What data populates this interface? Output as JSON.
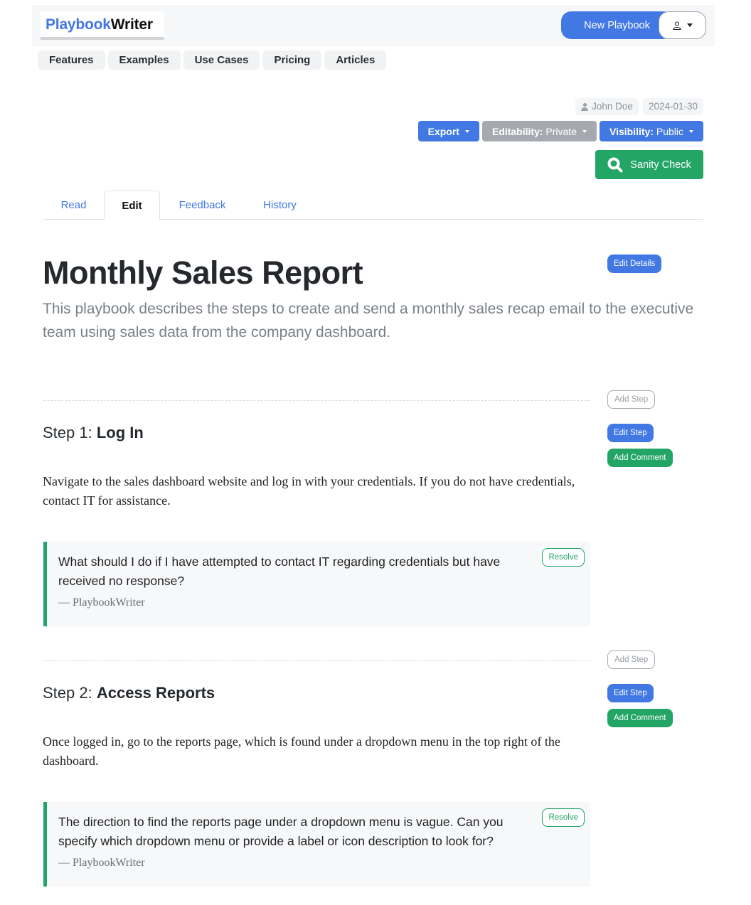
{
  "navbar": {
    "brand_part1": "Playbook",
    "brand_part2": "Writer",
    "new_playbook_label": "New Playbook",
    "user_menu_icon": "user-icon"
  },
  "subnav": {
    "items": [
      {
        "label": "Features"
      },
      {
        "label": "Examples"
      },
      {
        "label": "Use Cases"
      },
      {
        "label": "Pricing"
      },
      {
        "label": "Articles"
      }
    ]
  },
  "meta": {
    "author": "John Doe",
    "date": "2024-01-30"
  },
  "actions": {
    "export_label": "Export",
    "editability_key": "Editability:",
    "editability_value": "Private",
    "visibility_key": "Visibility:",
    "visibility_value": "Public",
    "sanity_check_label": "Sanity Check"
  },
  "tabs": [
    {
      "label": "Read",
      "active": false
    },
    {
      "label": "Edit",
      "active": true
    },
    {
      "label": "Feedback",
      "active": false
    },
    {
      "label": "History",
      "active": false
    }
  ],
  "playbook": {
    "title": "Monthly Sales Report",
    "description": "This playbook describes the steps to create and send a monthly sales recap email to the executive team using sales data from the company dashboard.",
    "edit_details_label": "Edit Details"
  },
  "step_buttons": {
    "add_step": "Add Step",
    "edit_step": "Edit Step",
    "add_comment": "Add Comment",
    "resolve": "Resolve"
  },
  "steps": [
    {
      "prefix": "Step 1: ",
      "name": "Log In",
      "body": "Navigate to the sales dashboard website and log in with your credentials. If you do not have credentials, contact IT for assistance.",
      "comment": {
        "text": "What should I do if I have attempted to contact IT regarding credentials but have received no response?",
        "author": "— PlaybookWriter"
      }
    },
    {
      "prefix": "Step 2: ",
      "name": "Access Reports",
      "body": "Once logged in, go to the reports page, which is found under a dropdown menu in the top right of the dashboard.",
      "comment": {
        "text": "The direction to find the reports page under a dropdown menu is vague. Can you specify which dropdown menu or provide a label or icon description to look for?",
        "author": "— PlaybookWriter"
      }
    }
  ],
  "colors": {
    "primary": "#4178e3",
    "success": "#22a565",
    "secondary": "#a6aab0"
  }
}
